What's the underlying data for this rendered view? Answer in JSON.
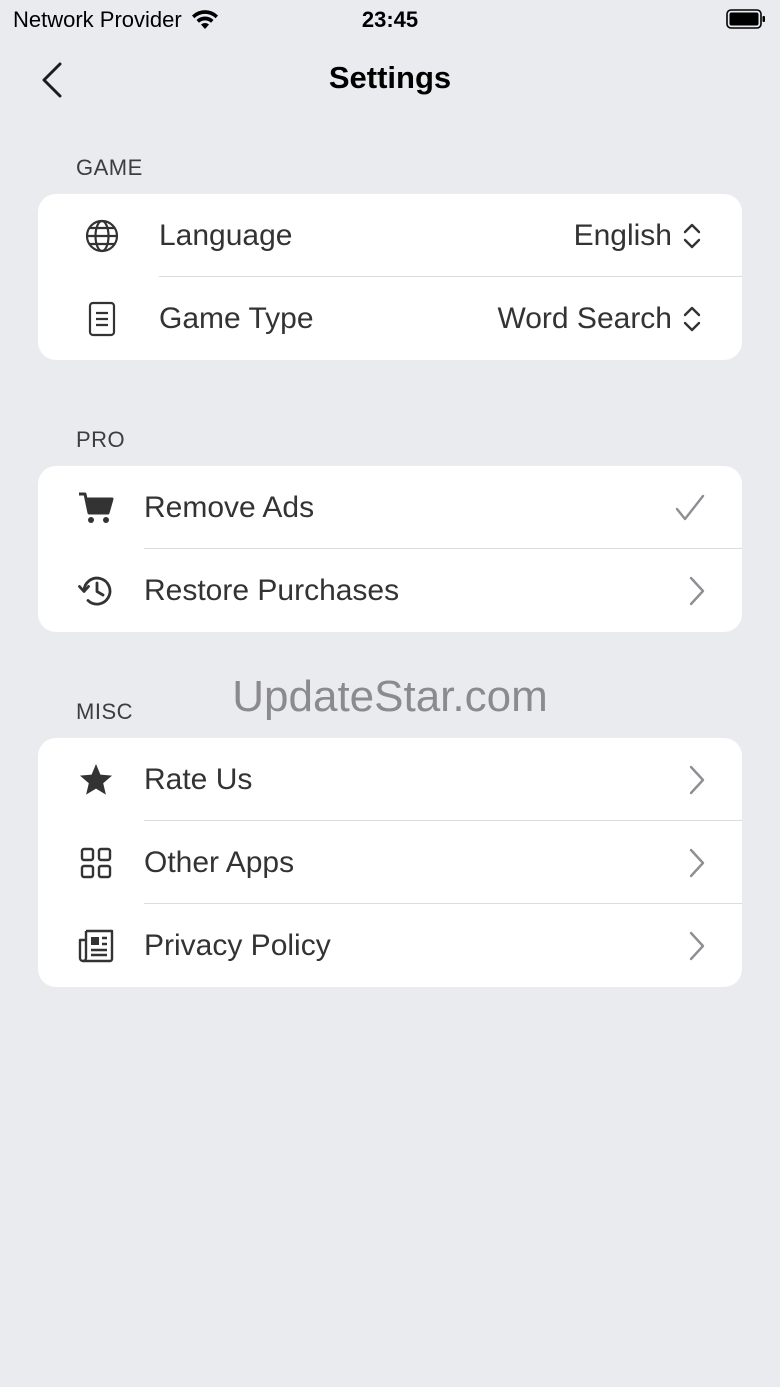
{
  "status_bar": {
    "carrier": "Network Provider",
    "time": "23:45"
  },
  "nav": {
    "title": "Settings"
  },
  "sections": {
    "game": {
      "header": "GAME",
      "language": {
        "label": "Language",
        "value": "English"
      },
      "game_type": {
        "label": "Game Type",
        "value": "Word Search"
      }
    },
    "pro": {
      "header": "PRO",
      "remove_ads": {
        "label": "Remove Ads"
      },
      "restore": {
        "label": "Restore Purchases"
      }
    },
    "misc": {
      "header": "MISC",
      "rate_us": {
        "label": "Rate Us"
      },
      "other_apps": {
        "label": "Other Apps"
      },
      "privacy": {
        "label": "Privacy Policy"
      }
    }
  },
  "watermark": "UpdateStar.com",
  "colors": {
    "background": "#EAEBEF",
    "card": "#FFFFFF",
    "text": "#333333",
    "chevron": "#8E8E93"
  }
}
